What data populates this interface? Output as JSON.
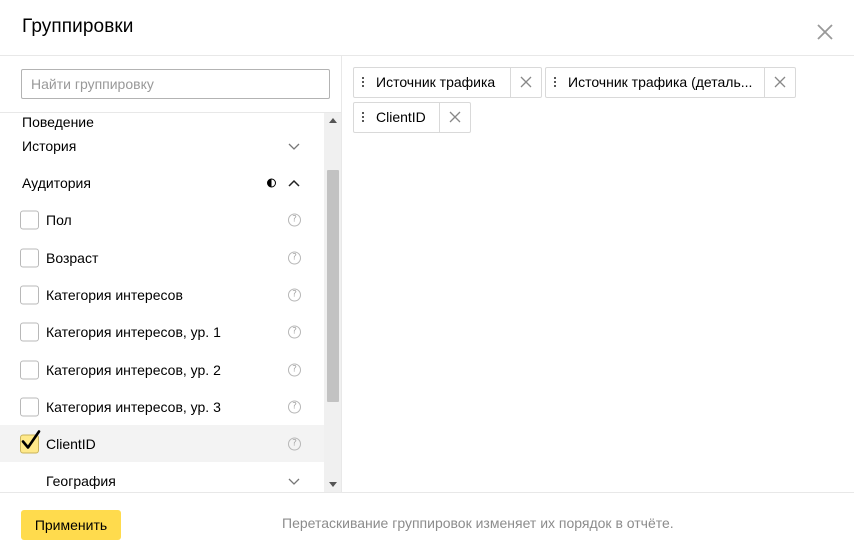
{
  "dialog": {
    "title": "Группировки"
  },
  "search": {
    "placeholder": "Найти группировку"
  },
  "list": {
    "cut_item": "Поведение",
    "sections": [
      {
        "label": "История",
        "expanded": false
      },
      {
        "label": "Аудитория",
        "expanded": true
      },
      {
        "label": "География",
        "expanded": false
      }
    ],
    "items": [
      {
        "label": "Пол",
        "checked": false
      },
      {
        "label": "Возраст",
        "checked": false
      },
      {
        "label": "Категория интересов",
        "checked": false
      },
      {
        "label": "Категория интересов, ур. 1",
        "checked": false
      },
      {
        "label": "Категория интересов, ур. 2",
        "checked": false
      },
      {
        "label": "Категория интересов, ур. 3",
        "checked": false
      },
      {
        "label": "ClientID",
        "checked": true
      }
    ],
    "help_glyph": "?"
  },
  "selected_groupings": [
    {
      "label": "Источник трафика"
    },
    {
      "label": "Источник трафика (деталь..."
    },
    {
      "label": "ClientID"
    }
  ],
  "footer": {
    "apply_label": "Применить",
    "hint": "Перетаскивание группировок изменяет их порядок в отчёте."
  },
  "colors": {
    "accent": "#ffdb4d",
    "checked_fill": "#ffe98a",
    "hint_text": "#8c8c8c",
    "border": "#e8e8e8"
  }
}
